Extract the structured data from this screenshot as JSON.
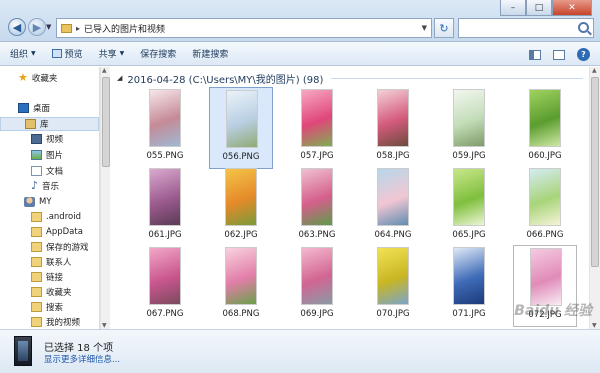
{
  "address": {
    "path": "已导入的图片和视频"
  },
  "toolbar": {
    "organize": "组织",
    "preview": "预览",
    "share": "共享",
    "save_search": "保存搜索",
    "new_search": "新建搜索"
  },
  "sidebar": {
    "favorites": "收藏夹",
    "desktop": "桌面",
    "library": "库",
    "videos": "视频",
    "pictures": "图片",
    "documents": "文档",
    "music": "音乐",
    "user": "MY",
    "android": ".android",
    "appdata": "AppData",
    "saved_games": "保存的游戏",
    "contacts": "联系人",
    "links": "链接",
    "user_favorites": "收藏夹",
    "searches": "搜索",
    "my_videos": "我的视频"
  },
  "group": {
    "header": "2016-04-28 (C:\\Users\\MY\\我的图片) (98)"
  },
  "files": [
    {
      "name": "055.PNG",
      "colors": [
        "#f7e7ea",
        "#c58a97",
        "#9fb9d4"
      ]
    },
    {
      "name": "056.PNG",
      "colors": [
        "#eaf2f8",
        "#b9cfe3",
        "#8faa75"
      ]
    },
    {
      "name": "057.JPG",
      "colors": [
        "#f7a8c3",
        "#e0477a",
        "#7fae52"
      ]
    },
    {
      "name": "058.JPG",
      "colors": [
        "#f4d0d8",
        "#d45b7c",
        "#6d4b3d"
      ]
    },
    {
      "name": "059.JPG",
      "colors": [
        "#f3f7f0",
        "#c3ddb8",
        "#7e9b68"
      ]
    },
    {
      "name": "060.JPG",
      "colors": [
        "#9fd25f",
        "#5b9d2f",
        "#cfe8a4"
      ]
    },
    {
      "name": "061.JPG",
      "colors": [
        "#d9aacf",
        "#9c5b8f",
        "#5a3b55"
      ]
    },
    {
      "name": "062.JPG",
      "colors": [
        "#f5c447",
        "#e58a2a",
        "#7a9a3a"
      ]
    },
    {
      "name": "063.PNG",
      "colors": [
        "#efc1d1",
        "#d55f8b",
        "#5f9b49"
      ]
    },
    {
      "name": "064.PNG",
      "colors": [
        "#b6d8ea",
        "#f2c6d4",
        "#5e8db1"
      ]
    },
    {
      "name": "065.JPG",
      "colors": [
        "#c9e78a",
        "#7fbf3e",
        "#eef6d5"
      ]
    },
    {
      "name": "066.PNG",
      "colors": [
        "#d4ecf3",
        "#a8d47a",
        "#f6f3d8"
      ]
    },
    {
      "name": "067.PNG",
      "colors": [
        "#f2a8c8",
        "#c9568e",
        "#7b4a5e"
      ]
    },
    {
      "name": "068.PNG",
      "colors": [
        "#f8d2df",
        "#e27ea8",
        "#6aa04a"
      ]
    },
    {
      "name": "069.JPG",
      "colors": [
        "#f4b9cf",
        "#d26592",
        "#8a9aa5"
      ]
    },
    {
      "name": "070.JPG",
      "colors": [
        "#f2e254",
        "#c9b623",
        "#7aa5c9"
      ]
    },
    {
      "name": "071.JPG",
      "colors": [
        "#dfeaf6",
        "#3f6bb8",
        "#1d3a7a"
      ]
    },
    {
      "name": "072.JPG",
      "colors": [
        "#f5cbe0",
        "#e08bb9",
        "#f8eef4"
      ]
    }
  ],
  "status": {
    "count": "已选择 18 个项",
    "more": "显示更多详细信息..."
  },
  "watermark": "Baidu 经验",
  "window": {
    "min": "–",
    "max": "□",
    "close": "✕"
  }
}
